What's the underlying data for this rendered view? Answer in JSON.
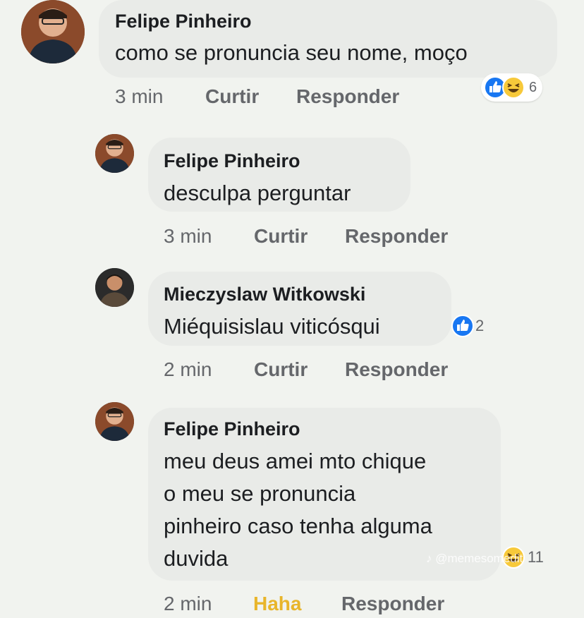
{
  "colors": {
    "background": "#f1f3ef",
    "bubble": "#e9ebe8",
    "meta_text": "#65676b",
    "like_blue": "#1877f2",
    "haha_yellow": "#e8b52a"
  },
  "comments": [
    {
      "author": "Felipe Pinheiro",
      "lines": [
        "como se pronuncia seu nome, moço"
      ],
      "time": "3 min",
      "like_label": "Curtir",
      "reply_label": "Responder",
      "reactions": {
        "icons": [
          "like-icon",
          "haha-icon"
        ],
        "count": "6"
      }
    },
    {
      "author": "Felipe Pinheiro",
      "lines": [
        "desculpa perguntar"
      ],
      "time": "3 min",
      "like_label": "Curtir",
      "reply_label": "Responder"
    },
    {
      "author": "Mieczyslaw Witkowski",
      "lines": [
        "Miéquisislau viticósqui"
      ],
      "time": "2 min",
      "like_label": "Curtir",
      "reply_label": "Responder",
      "reactions": {
        "icons": [
          "like-icon"
        ],
        "count": "2"
      }
    },
    {
      "author": "Felipe Pinheiro",
      "lines": [
        "meu deus amei mto chique",
        "o meu se pronuncia",
        "pinheiro caso tenha alguma",
        "duvida"
      ],
      "time": "2 min",
      "like_label": "Haha",
      "reply_label": "Responder",
      "reactions": {
        "icons": [
          "haha-icon"
        ],
        "count": "11"
      }
    }
  ],
  "watermark": "♪ @memesomedit"
}
